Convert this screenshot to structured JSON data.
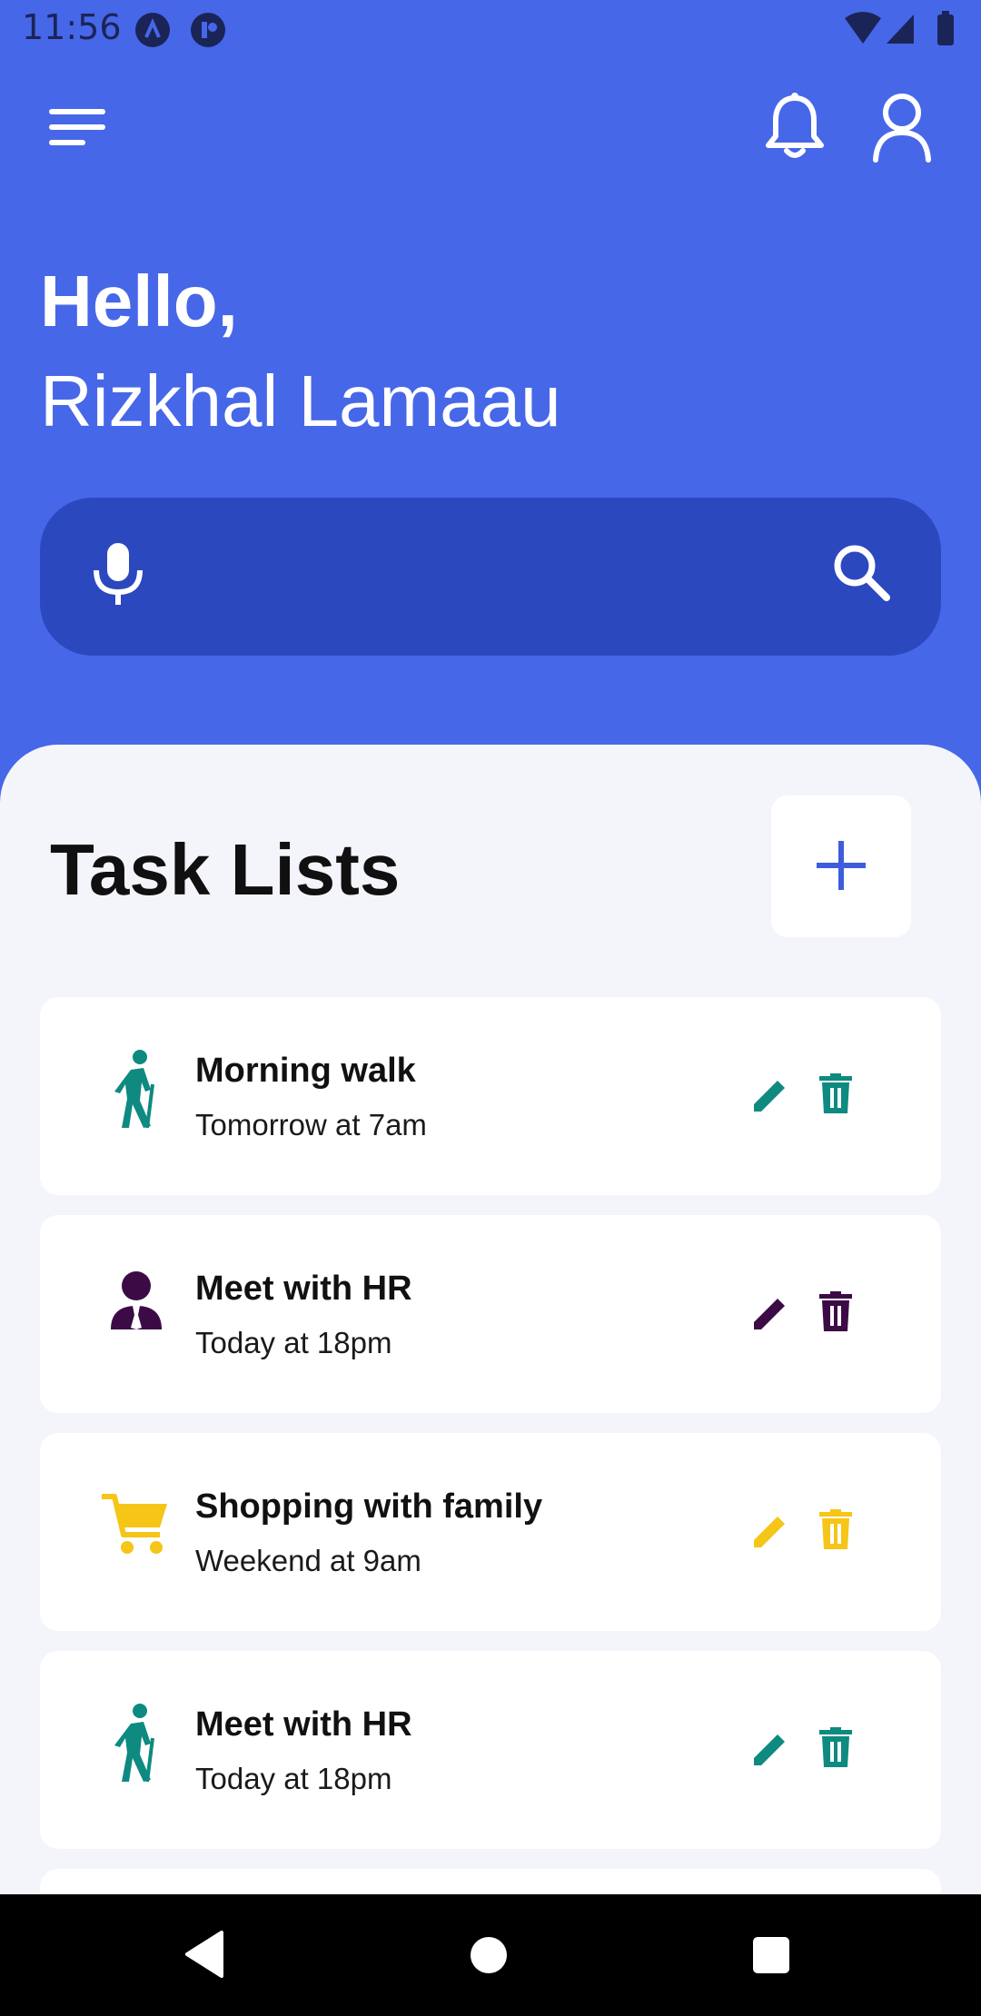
{
  "status_bar": {
    "time": "11:56",
    "icons": [
      "app-a-icon",
      "app-b-icon",
      "wifi-icon",
      "signal-icon",
      "battery-icon"
    ]
  },
  "header": {
    "greeting": "Hello,",
    "user_name": "Rizkhal Lamaau",
    "icons": [
      "menu-icon",
      "bell-icon",
      "profile-icon"
    ]
  },
  "search": {
    "placeholder": "",
    "value": "",
    "icons": [
      "microphone-icon",
      "search-icon"
    ]
  },
  "task_section": {
    "title": "Task Lists",
    "add_icon": "plus-icon"
  },
  "tasks": [
    {
      "title": "Morning walk",
      "subtitle": "Tomorrow at 7am",
      "icon": "hiking-icon",
      "color": "#0e8a80"
    },
    {
      "title": "Meet with HR",
      "subtitle": "Today at 18pm",
      "icon": "person-tie-icon",
      "color": "#3c0b45"
    },
    {
      "title": "Shopping with family",
      "subtitle": "Weekend at 9am",
      "icon": "cart-icon",
      "color": "#f5c518"
    },
    {
      "title": "Meet with HR",
      "subtitle": "Today at 18pm",
      "icon": "hiking-icon",
      "color": "#0e8a80"
    }
  ],
  "colors": {
    "header_bg": "#4667e8",
    "search_bg": "#2c48bf",
    "panel_bg": "#f4f5fb",
    "accent": "#3d5ddc"
  },
  "nav": {
    "icons": [
      "back-icon",
      "home-icon",
      "recents-icon"
    ]
  }
}
